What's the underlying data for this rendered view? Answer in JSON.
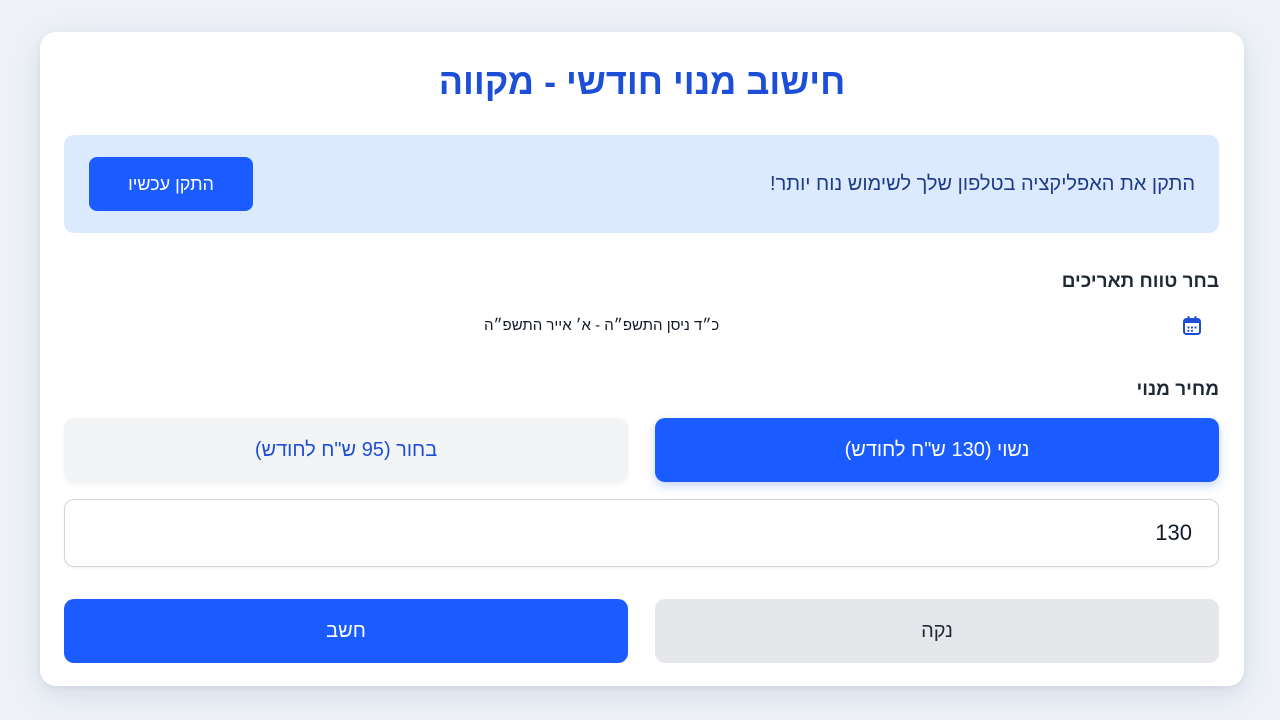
{
  "page": {
    "title": "חישוב מנוי חודשי - מקווה"
  },
  "banner": {
    "text": "התקן את האפליקציה בטלפון שלך לשימוש נוח יותר!",
    "install_label": "התקן עכשיו"
  },
  "dates": {
    "label": "בחר טווח תאריכים",
    "value": "כ״ד ניסן התשפ״ה - א׳ אייר התשפ״ה",
    "icon": "calendar-icon"
  },
  "price": {
    "label": "מחיר מנוי",
    "options": [
      {
        "label": "נשוי (130 ש\"ח לחודש)",
        "selected": true
      },
      {
        "label": "בחור (95 ש\"ח לחודש)",
        "selected": false
      }
    ],
    "input_value": "130"
  },
  "actions": {
    "clear_label": "נקה",
    "calculate_label": "חשב"
  },
  "colors": {
    "accent": "#1a5cff",
    "title": "#1d4ed8",
    "banner_bg": "#dbeafe",
    "page_bg": "#eef2f8"
  }
}
